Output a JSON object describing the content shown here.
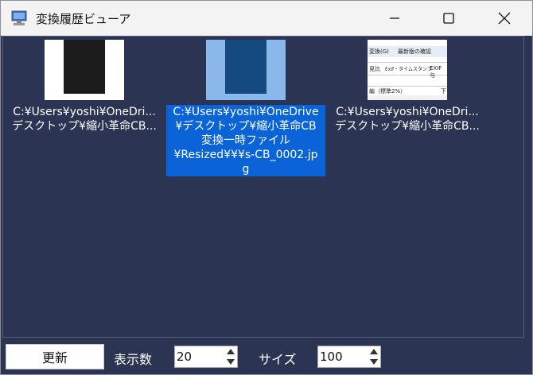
{
  "window": {
    "title": "変換履歴ビューア",
    "minimize_glyph": "—",
    "close_glyph": "✕"
  },
  "items": [
    {
      "line1": "C:¥Users¥yoshi¥OneDri...",
      "line2": "デスクトップ¥縮小革命CB...",
      "selected": false
    },
    {
      "line1": "C:¥Users¥yoshi¥OneDrive",
      "line2": "¥デスクトップ¥縮小革命CB",
      "line3": "変換一時ファイル",
      "line4": "¥Resized¥¥¥s-CB_0002.jp",
      "line5": "g",
      "selected": true
    },
    {
      "line1": "C:¥Users¥yoshi¥OneDri...",
      "line2": "デスクトップ¥縮小革命CB...",
      "selected": false,
      "thumb_text": {
        "menu1": "変換(G)",
        "menu2": "最新版の確認",
        "row1": "見比",
        "row2": "Exif・タイムスタンプ",
        "row3": "EXIF与",
        "row4": "編（標準2%）",
        "row5": "下"
      }
    }
  ],
  "toolbar": {
    "update_label": "更新",
    "count_label": "表示数",
    "count_value": "20",
    "size_label": "サイズ",
    "size_value": "100"
  }
}
